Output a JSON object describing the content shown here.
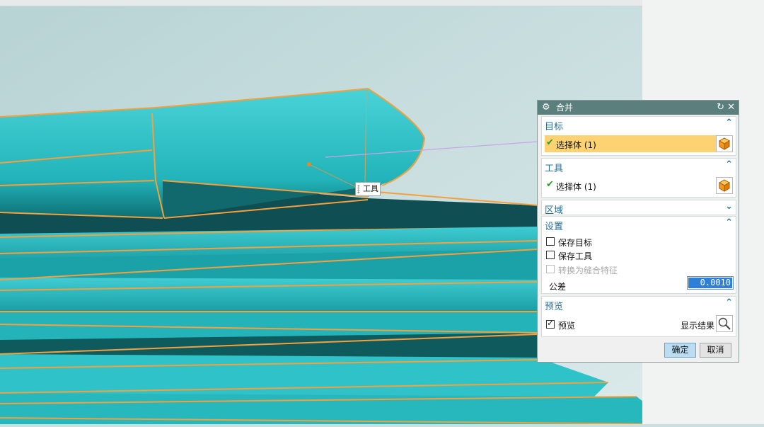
{
  "dialog": {
    "title": "合并",
    "icons": {
      "settings": "gear-icon",
      "reset": "reset-icon",
      "close": "close-icon"
    },
    "target": {
      "header": "目标",
      "selection": {
        "check": "✔",
        "label": "选择体 (1)"
      }
    },
    "tool": {
      "header": "工具",
      "selection": {
        "check": "✔",
        "label": "选择体 (1)"
      }
    },
    "region": {
      "header": "区域"
    },
    "settings": {
      "header": "设置",
      "keep_target": {
        "label": "保存目标",
        "checked": false
      },
      "keep_tool": {
        "label": "保存工具",
        "checked": false
      },
      "convert_to_sew": {
        "label": "转换为缝合特征",
        "checked": false,
        "disabled": true
      },
      "tolerance": {
        "label": "公差",
        "value": "0.0010"
      }
    },
    "preview": {
      "header": "预览",
      "preview_check": {
        "label": "预览",
        "checked": true
      },
      "show_result": "显示结果"
    },
    "buttons": {
      "ok": "确定",
      "cancel": "取消"
    }
  },
  "viewport": {
    "tool_tag": "工具",
    "colors": {
      "body": "#2ec9cf",
      "body_dark": "#0f5558",
      "edge": "#f4a03c",
      "background": "#c9dfe0"
    }
  }
}
